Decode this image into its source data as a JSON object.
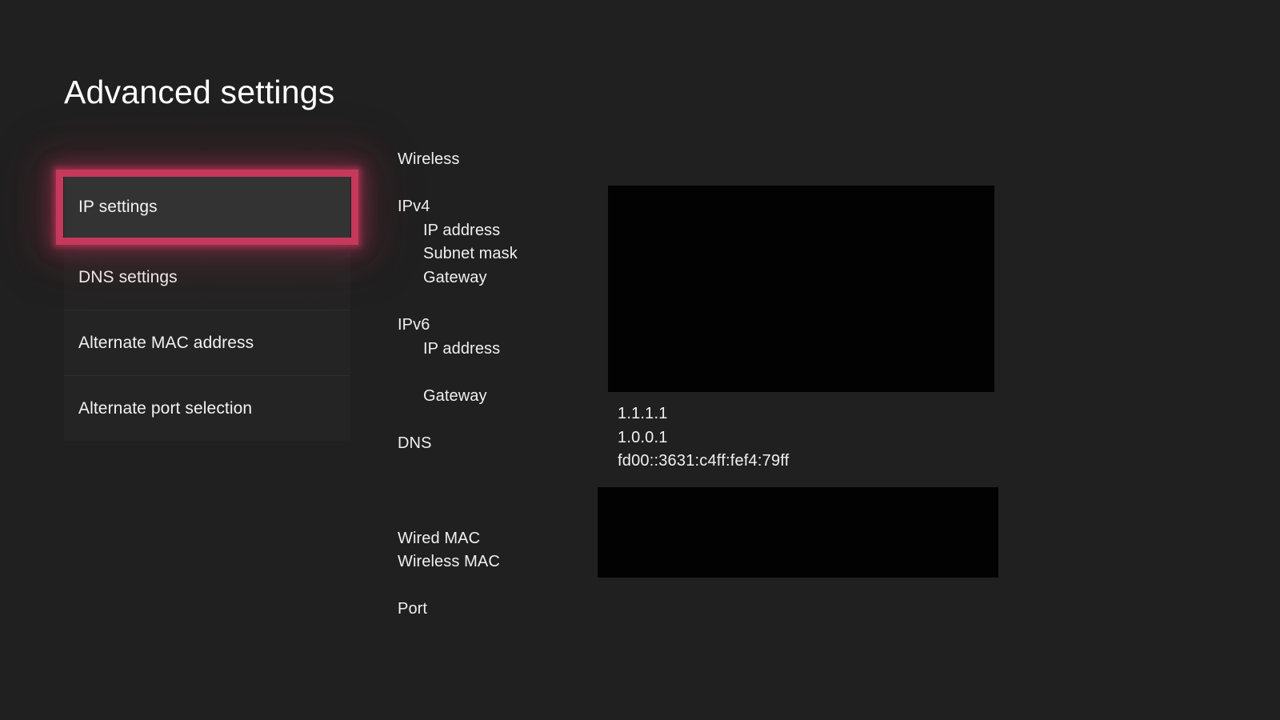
{
  "page": {
    "title": "Advanced settings",
    "background_color": "#202020",
    "text_color": "#f0f0f0"
  },
  "menu": {
    "selected_index": 0,
    "highlight_color": "#c6395c",
    "items": [
      {
        "label": "IP settings"
      },
      {
        "label": "DNS settings"
      },
      {
        "label": "Alternate MAC address"
      },
      {
        "label": "Alternate port selection"
      }
    ]
  },
  "info_panel": {
    "rows": [
      {
        "label": "Wireless",
        "indent": false
      },
      {
        "label": "",
        "indent": false
      },
      {
        "label": "IPv4",
        "indent": false
      },
      {
        "label": "IP address",
        "indent": true
      },
      {
        "label": "Subnet mask",
        "indent": true
      },
      {
        "label": "Gateway",
        "indent": true
      },
      {
        "label": "",
        "indent": false
      },
      {
        "label": "IPv6",
        "indent": false
      },
      {
        "label": "IP address",
        "indent": true
      },
      {
        "label": "",
        "indent": true
      },
      {
        "label": "Gateway",
        "indent": true
      },
      {
        "label": "",
        "indent": false
      },
      {
        "label": "DNS",
        "indent": false
      },
      {
        "label": "",
        "indent": false
      },
      {
        "label": "",
        "indent": false
      },
      {
        "label": "",
        "indent": false
      },
      {
        "label": "Wired MAC",
        "indent": false
      },
      {
        "label": "Wireless MAC",
        "indent": false
      },
      {
        "label": "",
        "indent": false
      },
      {
        "label": "Port",
        "indent": false
      }
    ],
    "dns_values": [
      "1.1.1.1",
      "1.0.0.1",
      "fd00::3631:c4ff:fef4:79ff"
    ],
    "redactions": [
      {
        "name": "redaction-top",
        "covers": "network-address-values"
      },
      {
        "name": "redaction-bottom",
        "covers": "mac-address-and-port-values"
      }
    ]
  }
}
